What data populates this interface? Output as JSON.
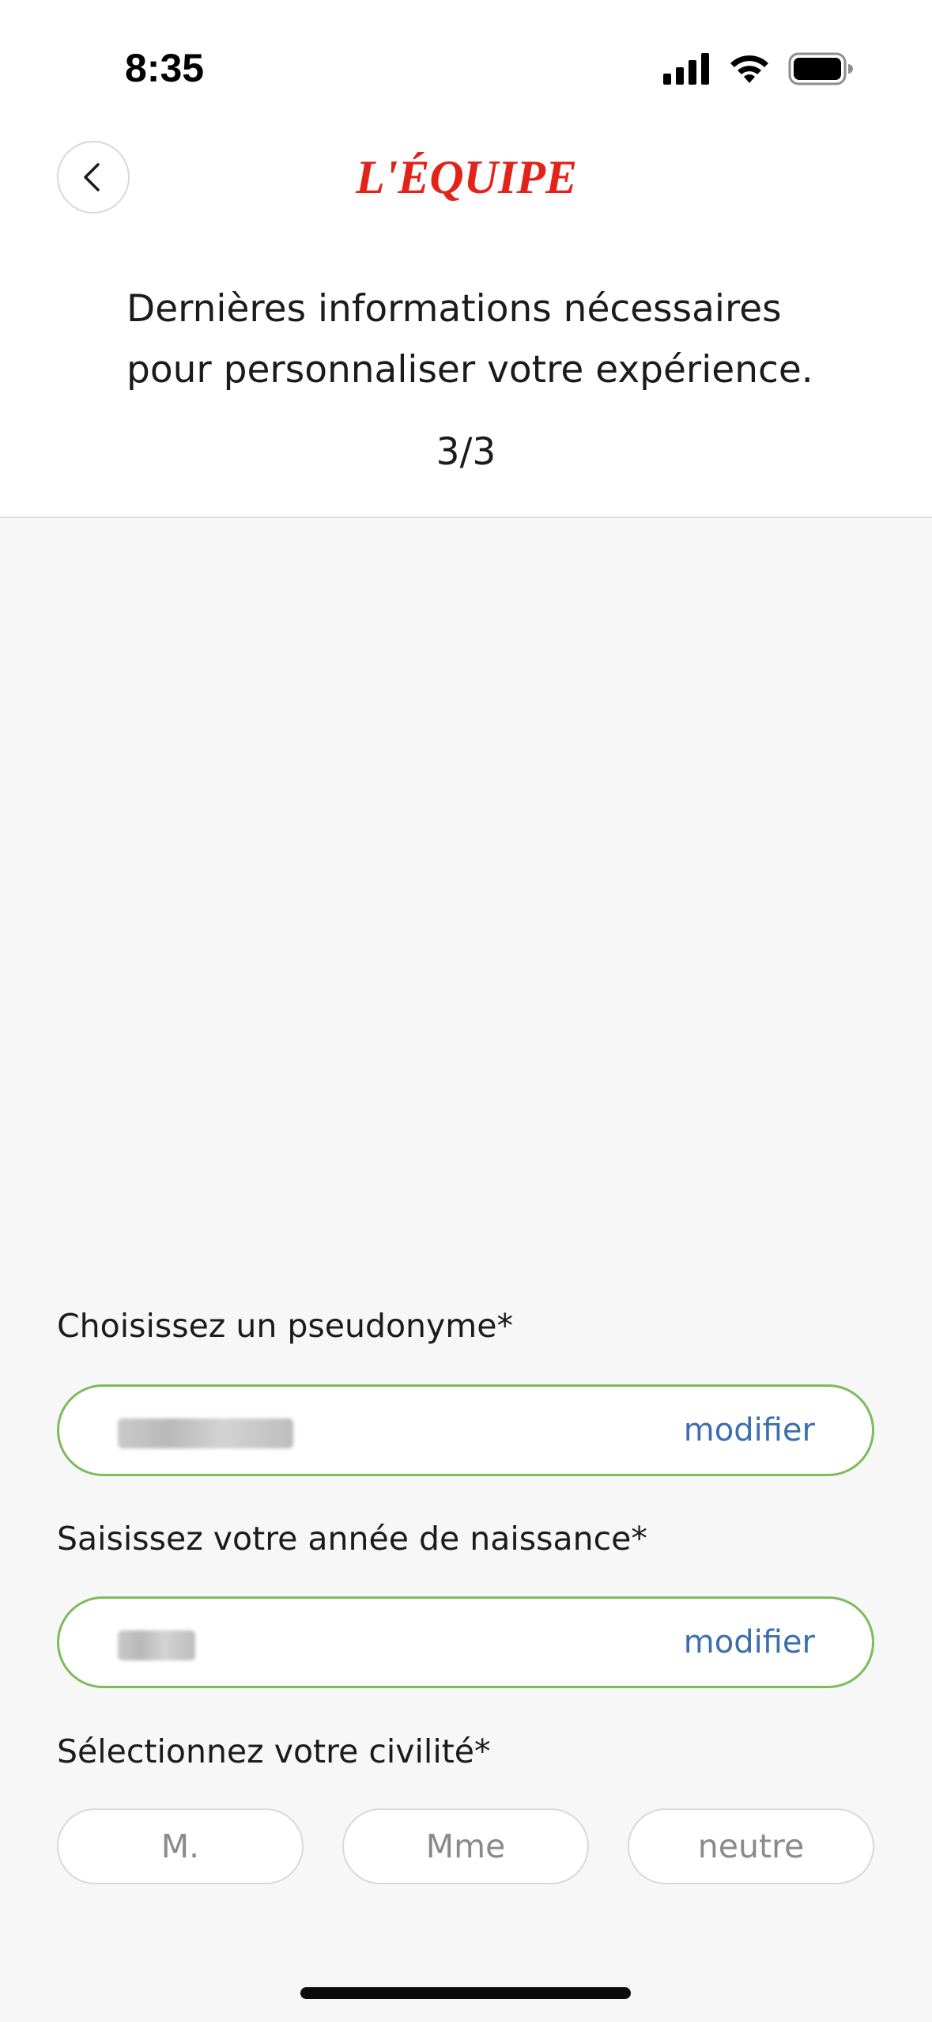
{
  "status_bar": {
    "time": "8:35"
  },
  "header": {
    "logo_text": "L'ÉQUIPE",
    "logo_color": "#e2231a",
    "back_icon": "chevron-left-icon"
  },
  "intro": {
    "line1": "Dernières informations nécessaires",
    "line2": "pour personnaliser votre expérience.",
    "step": "3/3"
  },
  "form": {
    "pseudonym": {
      "label": "Choisissez un pseudonyme*",
      "value_hidden": true,
      "action_label": "modifier"
    },
    "birth_year": {
      "label": "Saisissez votre année de naissance*",
      "value_hidden": true,
      "action_label": "modifier"
    },
    "civility": {
      "label": "Sélectionnez votre civilité*",
      "options": [
        "M.",
        "Mme",
        "neutre"
      ]
    }
  },
  "colors": {
    "accent_green": "#7dbb5c",
    "link_blue": "#3b6fad",
    "brand_red": "#e2231a"
  }
}
